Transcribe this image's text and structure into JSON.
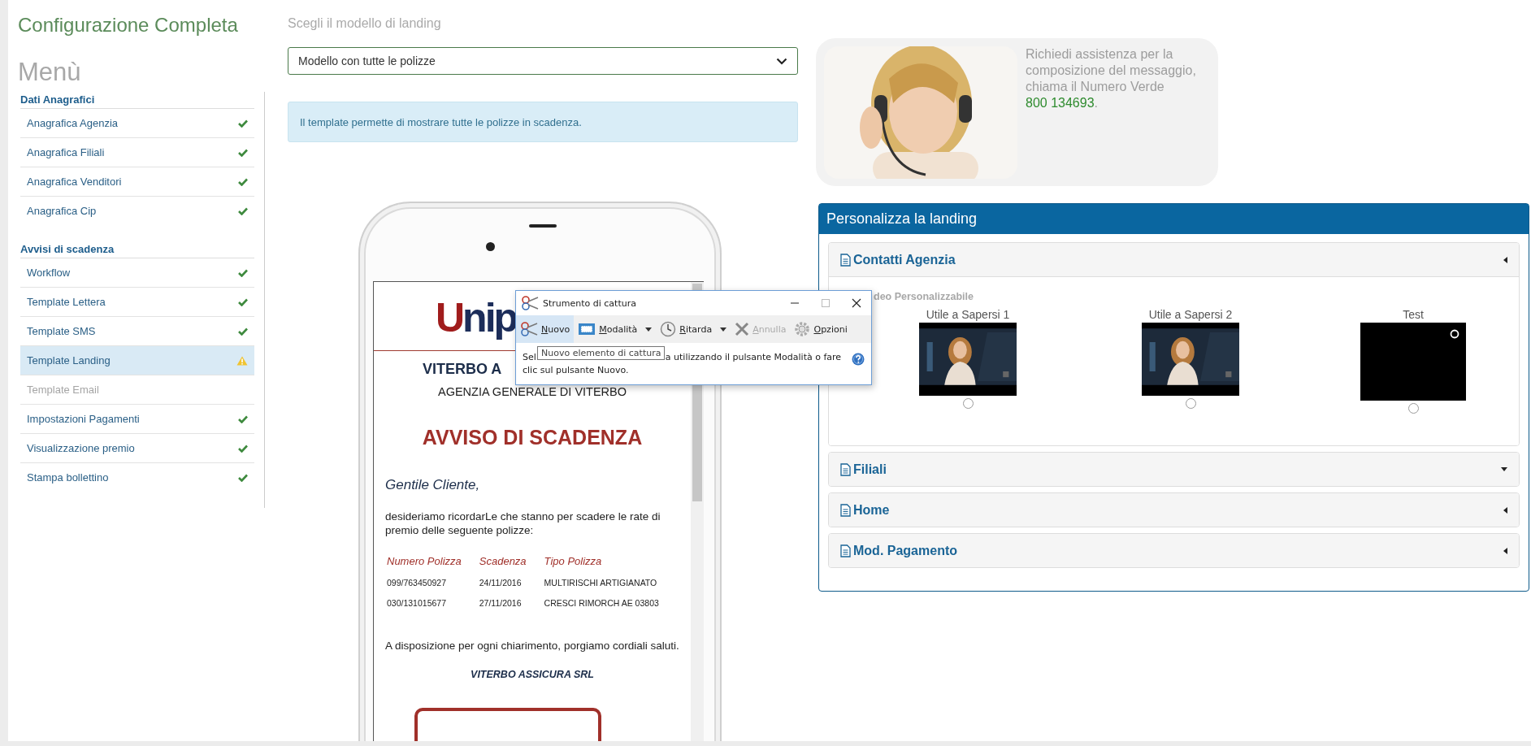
{
  "app": {
    "title": "Configurazione Completa",
    "menu_title": "Menù"
  },
  "sidebar": {
    "sections": [
      {
        "heading": "Dati Anagrafici",
        "items": [
          {
            "label": "Anagrafica Agenzia",
            "completed": true,
            "warning": false,
            "selected": false,
            "disabled": false
          },
          {
            "label": "Anagrafica Filiali",
            "completed": true,
            "warning": false,
            "selected": false,
            "disabled": false
          },
          {
            "label": "Anagrafica Venditori",
            "completed": true,
            "warning": false,
            "selected": false,
            "disabled": false
          },
          {
            "label": "Anagrafica Cip",
            "completed": true,
            "warning": false,
            "selected": false,
            "disabled": false
          }
        ]
      },
      {
        "heading": "Avvisi di scadenza",
        "items": [
          {
            "label": "Workflow",
            "completed": true,
            "warning": false,
            "selected": false,
            "disabled": false
          },
          {
            "label": "Template Lettera",
            "completed": true,
            "warning": false,
            "selected": false,
            "disabled": false
          },
          {
            "label": "Template SMS",
            "completed": true,
            "warning": false,
            "selected": false,
            "disabled": false
          },
          {
            "label": "Template Landing",
            "completed": false,
            "warning": true,
            "selected": true,
            "disabled": false
          },
          {
            "label": "Template Email",
            "completed": false,
            "warning": false,
            "selected": false,
            "disabled": true
          },
          {
            "label": "Impostazioni Pagamenti",
            "completed": true,
            "warning": false,
            "selected": false,
            "disabled": false
          },
          {
            "label": "Visualizzazione premio",
            "completed": true,
            "warning": false,
            "selected": false,
            "disabled": false
          },
          {
            "label": "Stampa bollettino",
            "completed": true,
            "warning": false,
            "selected": false,
            "disabled": false
          }
        ]
      }
    ]
  },
  "landing_model": {
    "label": "Scegli il modello di landing",
    "value": "Modello con tutte le polizze",
    "info": "Il template permette di mostrare tutte le polizze in scadenza."
  },
  "preview": {
    "logo": "Unip",
    "agency_name": "VITERBO A",
    "agency_subtitle": "AGENZIA GENERALE DI VITERBO",
    "notice_title": "AVVISO DI SCADENZA",
    "greeting": "Gentile Cliente,",
    "intro": "desideriamo ricordarLe che stanno per scadere le rate di premio delle seguente polizze:",
    "table": {
      "columns": [
        "Numero Polizza",
        "Scadenza",
        "Tipo Polizza"
      ],
      "rows": [
        [
          "099/763450927",
          "24/11/2016",
          "MULTIRISCHI ARTIGIANATO"
        ],
        [
          "030/131015677",
          "27/11/2016",
          "CRESCI RIMORCH AE 03803"
        ]
      ]
    },
    "closing": "A disposizione per ogni chiarimento, porgiamo cordiali saluti.",
    "signature": "VITERBO ASSICURA SRL"
  },
  "assistance": {
    "text": "Richiedi assistenza per la composizione del messaggio, chiama il Numero Verde",
    "phone": "800 134693",
    "end": "."
  },
  "customize_panel": {
    "title": "Personalizza la landing",
    "sections": [
      {
        "title": "Contatti Agenzia",
        "caret_down": false,
        "expanded": true,
        "video_label": "deo Personalizzabile",
        "videos": [
          {
            "title": "Utile a Sapersi 1",
            "kind": "picture",
            "selected": false
          },
          {
            "title": "Utile a Sapersi 2",
            "kind": "picture",
            "selected": false
          },
          {
            "title": "Test",
            "kind": "blank",
            "selected": false
          }
        ]
      },
      {
        "title": "Filiali",
        "caret_down": true,
        "expanded": false
      },
      {
        "title": "Home",
        "caret_down": false,
        "expanded": false
      },
      {
        "title": "Mod. Pagamento",
        "caret_down": false,
        "expanded": false
      }
    ]
  },
  "snipping_tool": {
    "title": "Strumento di cattura",
    "buttons": [
      {
        "label": "Nuovo",
        "kind": "new",
        "dropdown": false,
        "disabled": false,
        "highlighted": true
      },
      {
        "label": "Modalità",
        "kind": "mode",
        "dropdown": true,
        "disabled": false,
        "highlighted": false
      },
      {
        "label": "Ritarda",
        "kind": "delay",
        "dropdown": true,
        "disabled": false,
        "highlighted": false
      },
      {
        "label": "Annulla",
        "kind": "cancel",
        "dropdown": false,
        "disabled": true,
        "highlighted": false
      },
      {
        "label": "Opzioni",
        "kind": "options",
        "dropdown": false,
        "disabled": false,
        "highlighted": false
      }
    ],
    "tooltip": "Nuovo elemento di cattura",
    "description_start": "Sel",
    "description_line_1": "a utilizzando il pulsante Modalità o fare",
    "description_line_2": "clic sul pulsante Nuovo."
  }
}
